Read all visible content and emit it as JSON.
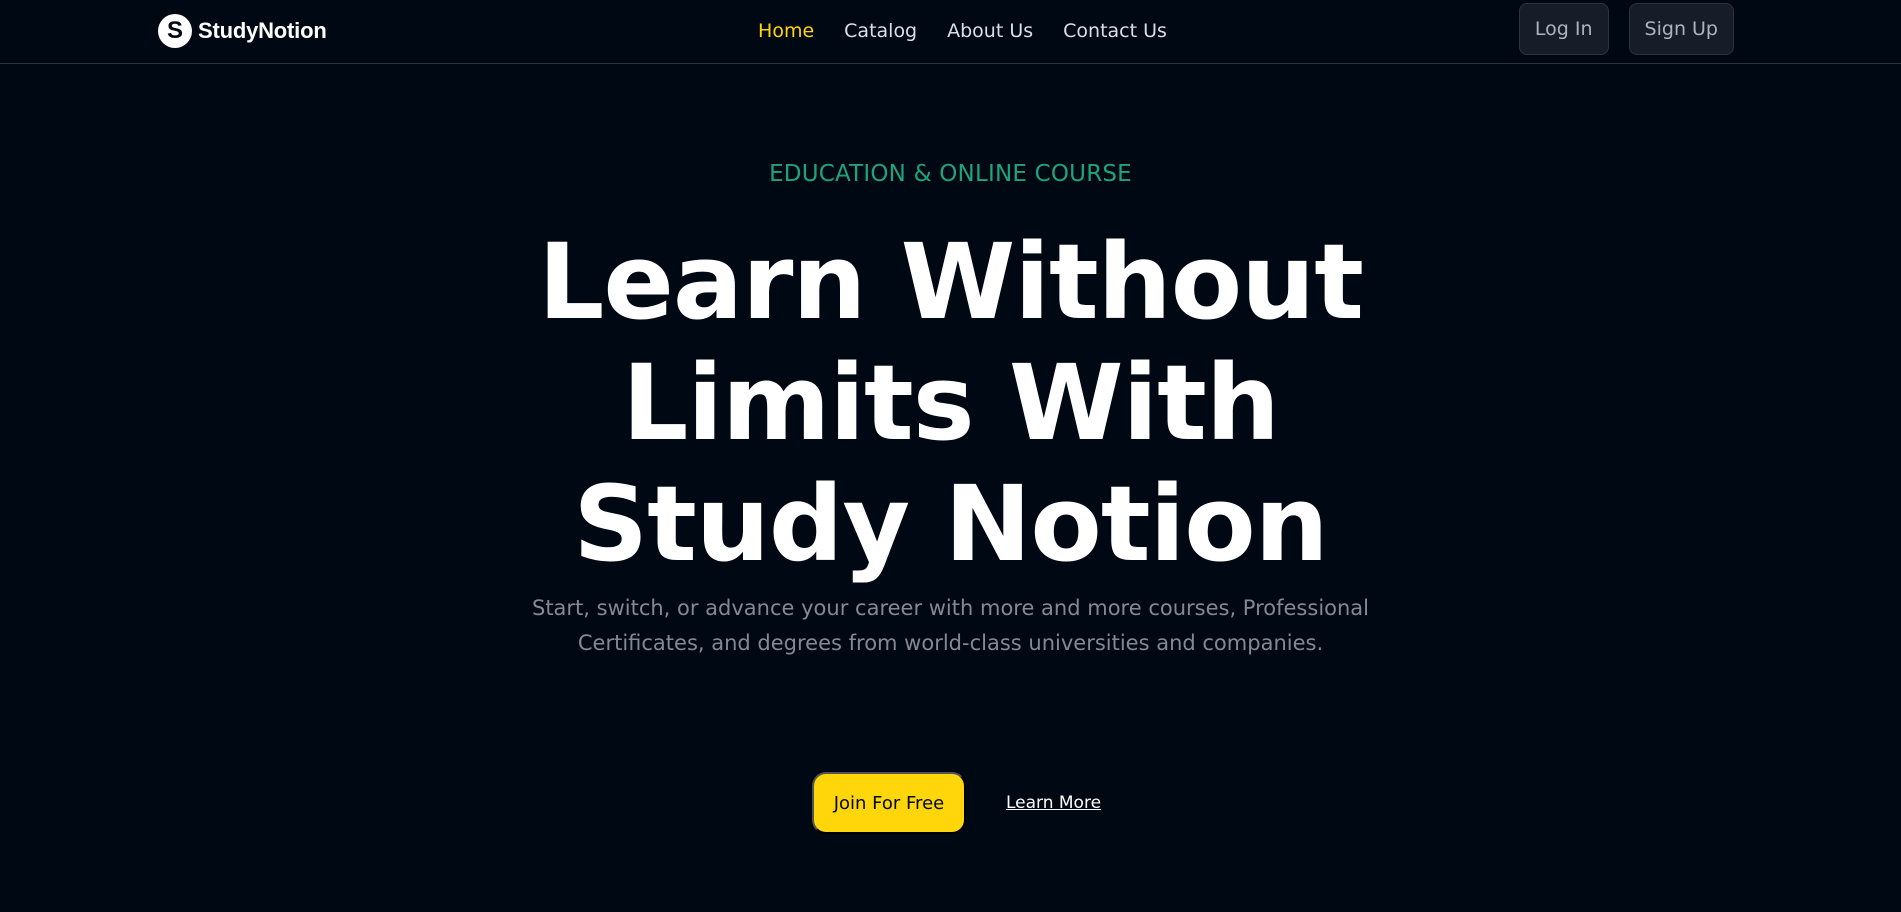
{
  "brand": {
    "logo_letter": "S",
    "name": "StudyNotion"
  },
  "nav": {
    "items": [
      {
        "label": "Home",
        "active": true
      },
      {
        "label": "Catalog",
        "active": false
      },
      {
        "label": "About Us",
        "active": false
      },
      {
        "label": "Contact Us",
        "active": false
      }
    ]
  },
  "auth": {
    "login_label": "Log In",
    "signup_label": "Sign Up"
  },
  "hero": {
    "eyebrow": "EDUCATION & ONLINE COURSE",
    "headline_lines": [
      "Learn Without",
      "Limits With",
      "Study Notion"
    ],
    "subtitle_lines": [
      "Start, switch, or advance your career with more and more courses, Professional",
      "Certificates, and degrees from world-class universities and companies."
    ],
    "primary_cta": "Join For Free",
    "secondary_cta": "Learn More"
  },
  "colors": {
    "background": "#000814",
    "accent": "#FFD60A",
    "eyebrow": "#1FA37A",
    "muted_text": "#838894"
  }
}
